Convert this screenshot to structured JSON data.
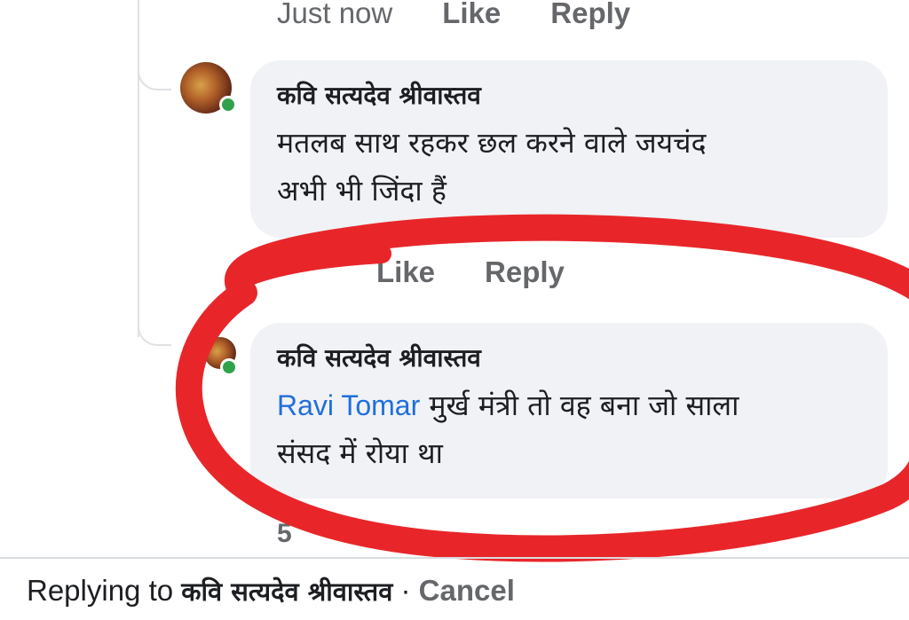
{
  "top_meta": {
    "time": "Just now",
    "like": "Like",
    "reply": "Reply"
  },
  "comments": [
    {
      "author": "कवि सत्यदेव श्रीवास्तव",
      "text": "मतलब साथ रहकर छल करने वाले जयचंद",
      "text_line2": "अभी भी जिंदा हैं",
      "online": true
    },
    {
      "author": "कवि सत्यदेव श्रीवास्तव",
      "mention": "Ravi Tomar",
      "text": "मुर्ख मंत्री तो वह बना जो  साला",
      "text_line2": "संसद में रोया था",
      "online": true
    }
  ],
  "mid_meta": {
    "like": "Like",
    "reply": "Reply"
  },
  "partial_meta": "5",
  "reply_bar": {
    "prefix": "Replying to ",
    "name": "कवि सत्यदेव श्रीवास्तव",
    "separator": " · ",
    "cancel": "Cancel"
  },
  "colors": {
    "bubble": "#f0f2f5",
    "mention": "#216fdb",
    "meta_text": "#65676b",
    "online": "#31a24c",
    "highlight_marker": "#e8262a"
  }
}
